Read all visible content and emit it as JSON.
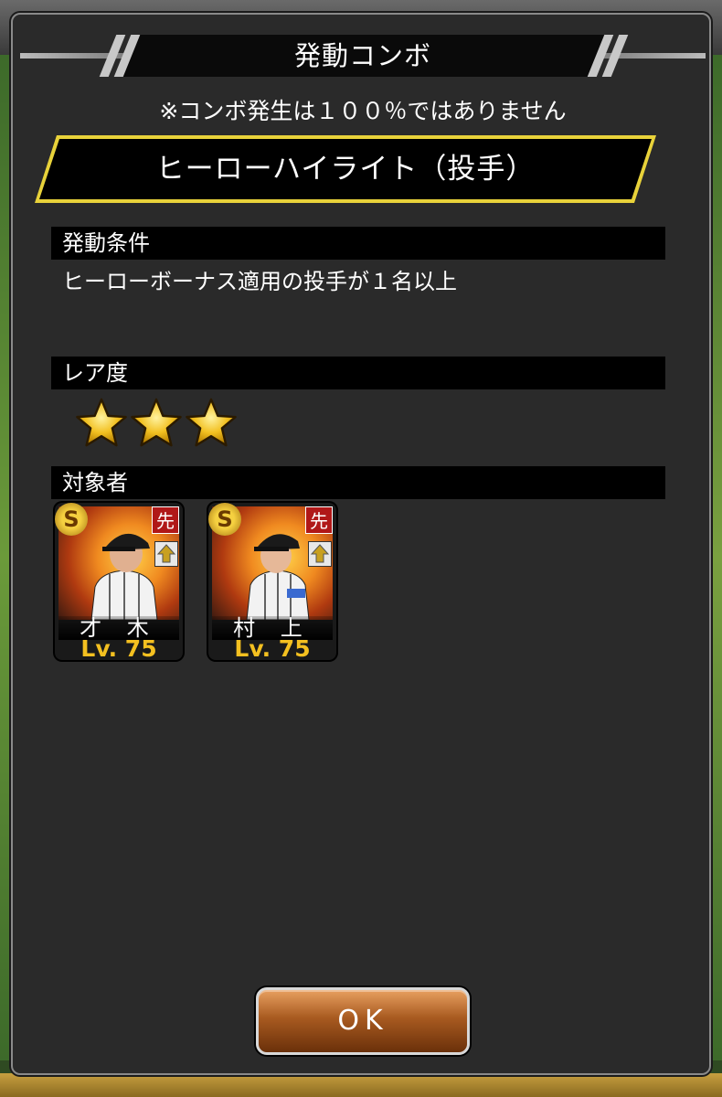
{
  "dialog": {
    "title": "発動コンボ",
    "note": "※コンボ発生は１００％ではありません",
    "combo_name": "ヒーローハイライト（投手）"
  },
  "sections": {
    "condition": {
      "label": "発動条件",
      "text": "ヒーローボーナス適用の投手が１名以上"
    },
    "rarity": {
      "label": "レア度",
      "stars": 3
    },
    "targets": {
      "label": "対象者",
      "players": [
        {
          "name": "才 木",
          "level": "Lv. 75",
          "position_badge": "先",
          "rank_badge": "S"
        },
        {
          "name": "村 上",
          "level": "Lv. 75",
          "position_badge": "先",
          "rank_badge": "S"
        }
      ]
    }
  },
  "ok_button": {
    "label": "OK"
  },
  "colors": {
    "panel_bg": "#2a2a2a",
    "accent_yellow": "#e8d23a",
    "level_gold": "#f4c020",
    "ok_brown": "#a85a20",
    "badge_red": "#b01818"
  }
}
